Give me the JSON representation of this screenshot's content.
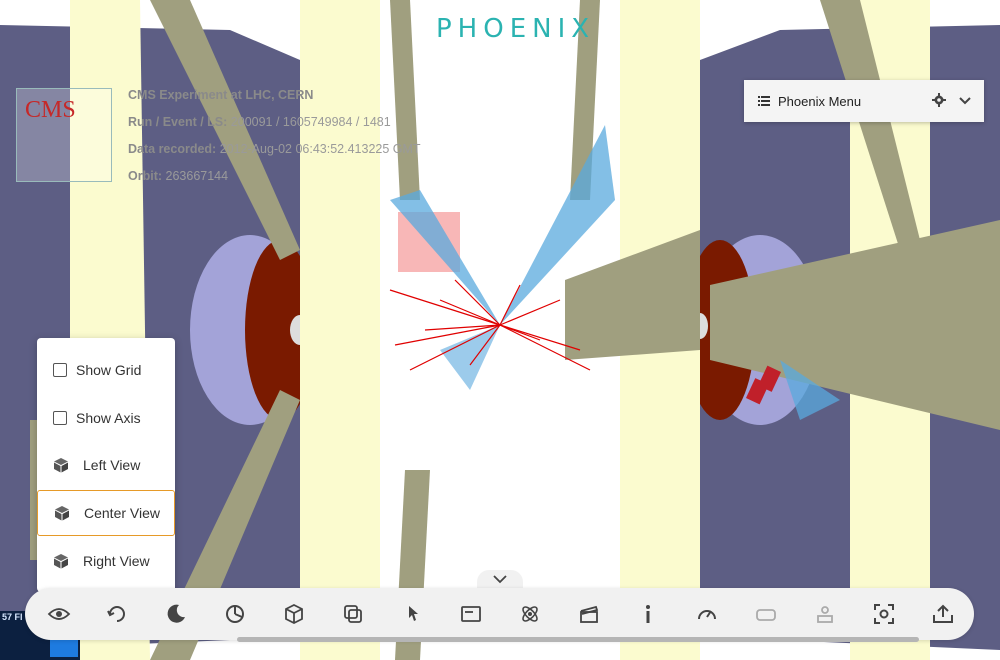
{
  "app": {
    "logo": "PHOENIX"
  },
  "event_info": {
    "title": "CMS Experiment at LHC, CERN",
    "run_label": "Run / Event / LS:",
    "run_value": "200091 / 1605749984 / 1481",
    "data_label": "Data recorded:",
    "data_value": "2012-Aug-02 06:43:52.413225 GMT",
    "orbit_label": "Orbit:",
    "orbit_value": "263667144"
  },
  "cms_logo": {
    "text": "CMS"
  },
  "menu": {
    "label": "Phoenix Menu"
  },
  "view_popup": {
    "items": [
      {
        "label": "Show Grid",
        "icon": "checkbox"
      },
      {
        "label": "Show Axis",
        "icon": "checkbox"
      },
      {
        "label": "Left View",
        "icon": "cube-icon"
      },
      {
        "label": "Center View",
        "icon": "cube-icon",
        "selected": true
      },
      {
        "label": "Right View",
        "icon": "cube-icon"
      }
    ]
  },
  "toolbar": {
    "buttons": [
      "eye-icon",
      "rotate-icon",
      "dark-mode-icon",
      "chart-icon",
      "cube-icon",
      "layers-icon",
      "pointer-icon",
      "panel-icon",
      "atom-icon",
      "clapper-icon",
      "info-icon",
      "speedometer-icon",
      "vr-icon",
      "ar-icon",
      "screenshot-icon",
      "upload-icon"
    ]
  },
  "mini_overlay": {
    "text": "57 FI"
  },
  "colors": {
    "accent": "#e69a28",
    "logo_teal": "#2bb3b1",
    "logo_yellow": "#e6e04a",
    "detector_purple": "#5d5e84"
  }
}
